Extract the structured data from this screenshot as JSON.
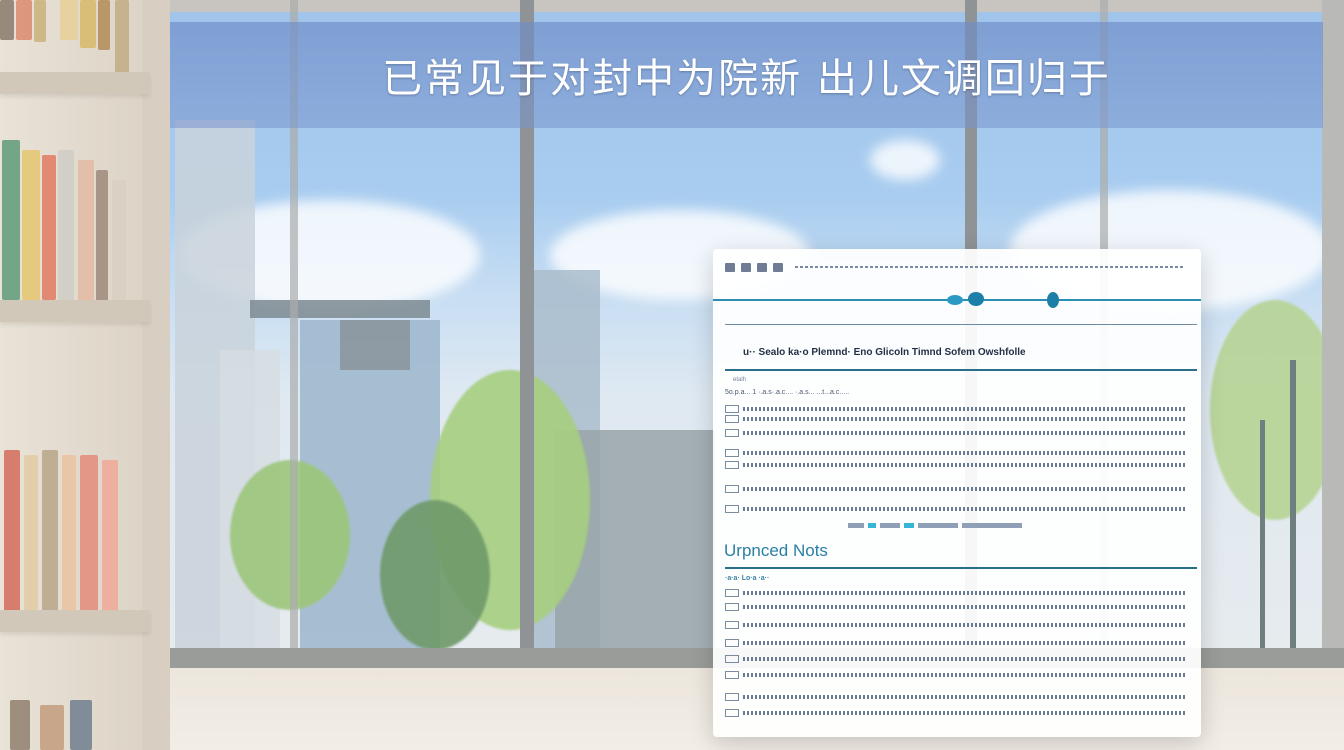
{
  "banner": {
    "title": "已常见于对封中为院新 出儿文调回归于"
  },
  "document": {
    "header_text": "• • • • •",
    "section_heading": "u·· Sealo ka·o Plemnd· Eno Glicoln Timnd Sofem Owshfolle",
    "intro_label": "etalh",
    "intro_line": "5o.p.a... 1 ·.a.s·.a.c.... ·.a.s... ...t...a.c.....",
    "notes_heading": "Urpnced Nots",
    "notes_sub": "·a·a· Lo·a ·a··"
  },
  "colors": {
    "accent": "#2a7fa6",
    "banner": "#7a96cf"
  }
}
